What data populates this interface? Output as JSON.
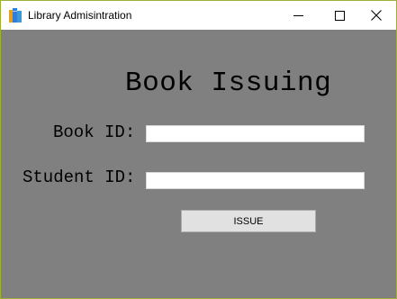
{
  "window": {
    "title": "Library Admisintration",
    "controls": {
      "minimize_icon": "minimize-icon",
      "maximize_icon": "maximize-icon",
      "close_icon": "close-icon"
    }
  },
  "form": {
    "heading": "Book Issuing",
    "book_id_label": "Book ID:",
    "book_id_value": "",
    "student_id_label": "Student ID:",
    "student_id_value": "",
    "issue_button": "ISSUE"
  },
  "colors": {
    "background": "#808080",
    "window_border": "#9fae3a",
    "button_face": "#e1e1e1"
  }
}
